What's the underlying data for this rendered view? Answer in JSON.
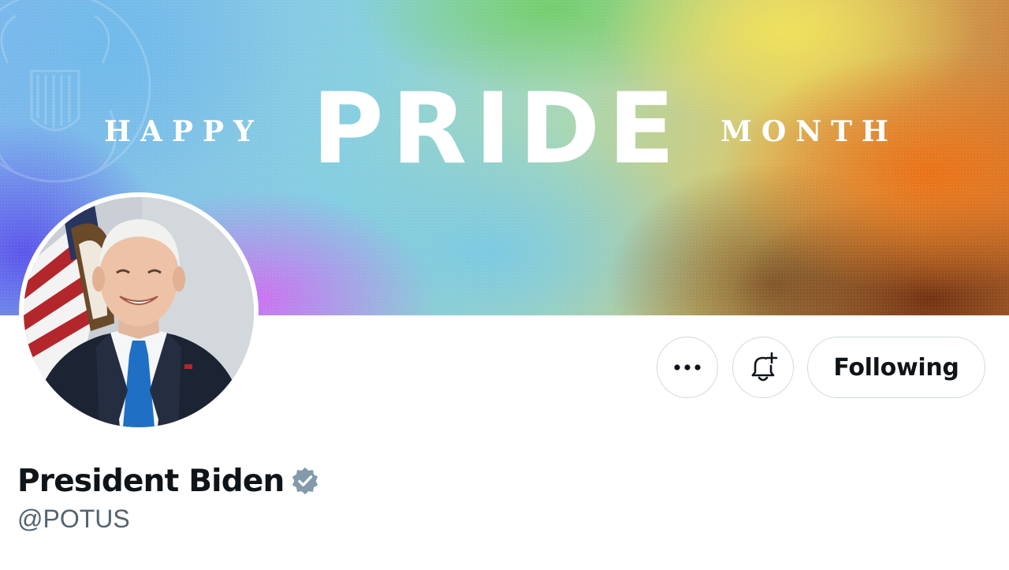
{
  "banner": {
    "happy": "HAPPY",
    "pride": "PRIDE",
    "month": "MONTH"
  },
  "profile": {
    "display_name": "President Biden",
    "handle": "@POTUS",
    "verified": true
  },
  "actions": {
    "more_icon": "more-horizontal-icon",
    "notify_icon": "bell-plus-icon",
    "follow_label": "Following"
  },
  "colors": {
    "text_primary": "#0f1419",
    "text_secondary": "#536471",
    "button_border": "#cfd9de",
    "verified_badge": "#829aab"
  }
}
